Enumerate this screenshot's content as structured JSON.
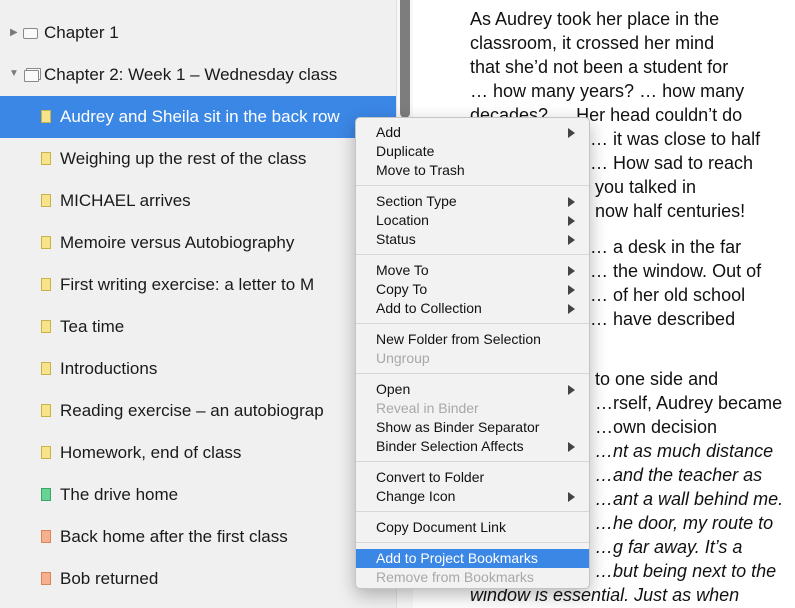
{
  "binder": {
    "items": [
      {
        "label": "Chapter 1",
        "icon": "folder-icon"
      },
      {
        "label": "Chapter 2: Week 1 – Wednesday class",
        "icon": "stack-folder-icon"
      },
      {
        "label": "Audrey and Sheila sit in the back row",
        "icon": "document-icon",
        "color": "yellow"
      },
      {
        "label": "Weighing up the rest of the class",
        "icon": "document-icon",
        "color": "yellow"
      },
      {
        "label": "MICHAEL arrives",
        "icon": "document-icon",
        "color": "yellow"
      },
      {
        "label": "Memoire versus Autobiography",
        "icon": "document-icon",
        "color": "yellow"
      },
      {
        "label": "First writing exercise: a letter to M",
        "icon": "document-icon",
        "color": "yellow"
      },
      {
        "label": "Tea time",
        "icon": "document-icon",
        "color": "yellow"
      },
      {
        "label": "Introductions",
        "icon": "document-icon",
        "color": "yellow"
      },
      {
        "label": "Reading exercise – an autobiograp",
        "icon": "document-icon",
        "color": "yellow"
      },
      {
        "label": "Homework, end of class",
        "icon": "document-icon",
        "color": "yellow"
      },
      {
        "label": "The drive home",
        "icon": "document-icon",
        "color": "green"
      },
      {
        "label": "Back home after the first class",
        "icon": "document-icon",
        "color": "orange"
      },
      {
        "label": "Bob returned",
        "icon": "document-icon",
        "color": "orange"
      }
    ]
  },
  "editor": {
    "p1": [
      "As Audrey took her place in the",
      "classroom, it crossed her mind",
      "that she’d not been a student for",
      "… how many years? … how many",
      "decades? … Her head couldn’t do",
      "… it was close to half",
      "… How sad to reach",
      "you talked in",
      "now half centuries!"
    ],
    "p2": [
      "… a desk in the far",
      "… the window. Out of",
      "… of her old school",
      "… have described"
    ],
    "p3": [
      "to one side and",
      "…rself, Audrey became",
      "…own decision",
      "…nt as much distance",
      "…and the teacher as",
      "…ant a wall behind me.",
      "…he door, my route to",
      "…g far away. It’s a",
      "…but being next to the",
      "window is essential. Just as when"
    ]
  },
  "context_menu": {
    "groups": [
      [
        {
          "label": "Add",
          "submenu": true
        },
        {
          "label": "Duplicate"
        },
        {
          "label": "Move to Trash"
        }
      ],
      [
        {
          "label": "Section Type",
          "submenu": true
        },
        {
          "label": "Location",
          "submenu": true
        },
        {
          "label": "Status",
          "submenu": true
        }
      ],
      [
        {
          "label": "Move To",
          "submenu": true
        },
        {
          "label": "Copy To",
          "submenu": true
        },
        {
          "label": "Add to Collection",
          "submenu": true
        }
      ],
      [
        {
          "label": "New Folder from Selection"
        },
        {
          "label": "Ungroup",
          "disabled": true
        }
      ],
      [
        {
          "label": "Open",
          "submenu": true
        },
        {
          "label": "Reveal in Binder",
          "disabled": true
        },
        {
          "label": "Show as Binder Separator"
        },
        {
          "label": "Binder Selection Affects",
          "submenu": true
        }
      ],
      [
        {
          "label": "Convert to Folder"
        },
        {
          "label": "Change Icon",
          "submenu": true
        }
      ],
      [
        {
          "label": "Copy Document Link"
        }
      ],
      [
        {
          "label": "Add to Project Bookmarks",
          "highlighted": true
        },
        {
          "label": "Remove from Bookmarks",
          "disabled": true
        }
      ]
    ]
  },
  "colors": {
    "selection": "#3b87e6",
    "binder_bg": "#f0f0f0",
    "menu_bg": "#f2f2f2",
    "doc_yellow": "#f6e38a",
    "doc_green": "#66d394",
    "doc_orange": "#f6b08e"
  }
}
